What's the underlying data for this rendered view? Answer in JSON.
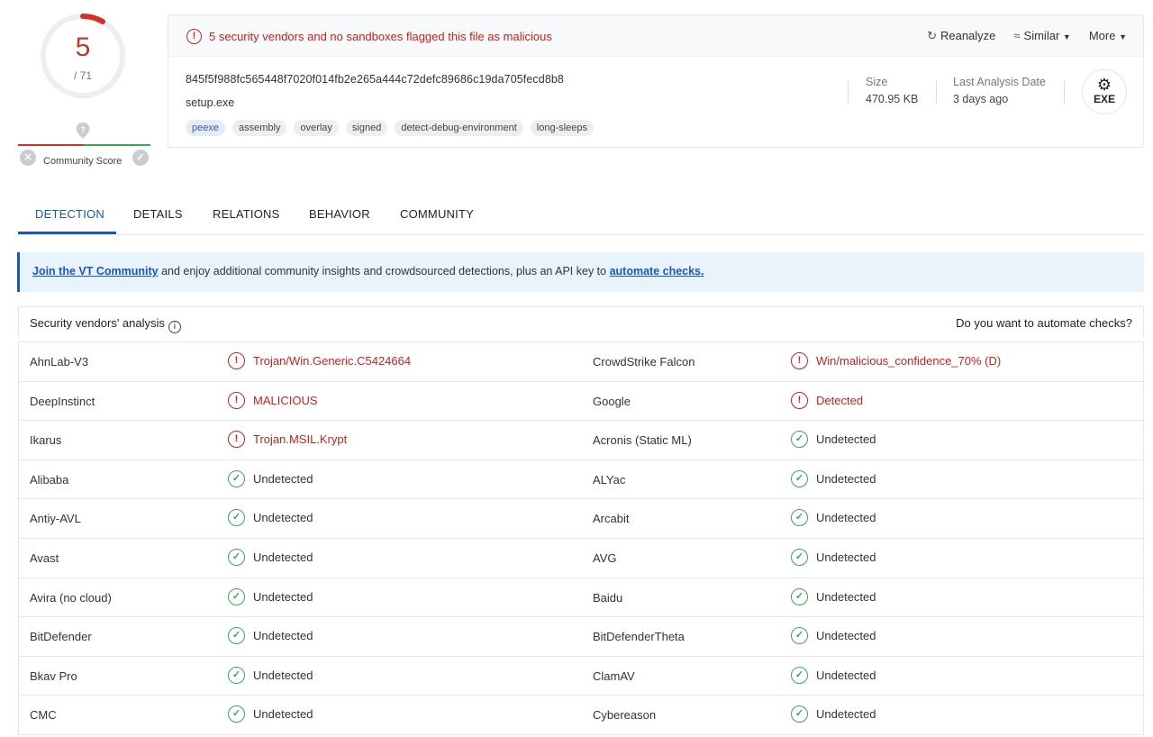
{
  "score": {
    "detections": "5",
    "total": "/ 71"
  },
  "community": {
    "label": "Community Score"
  },
  "alert": {
    "text": "5 security vendors and no sandboxes flagged this file as malicious"
  },
  "actions": {
    "reanalyze": "Reanalyze",
    "similar": "Similar",
    "more": "More"
  },
  "file": {
    "hash": "845f5f988fc565448f7020f014fb2e265a444c72defc89686c19da705fecd8b8",
    "name": "setup.exe",
    "tags": [
      "peexe",
      "assembly",
      "overlay",
      "signed",
      "detect-debug-environment",
      "long-sleeps"
    ],
    "size_label": "Size",
    "size": "470.95 KB",
    "date_label": "Last Analysis Date",
    "date": "3 days ago",
    "type": "EXE"
  },
  "tabs": [
    "DETECTION",
    "DETAILS",
    "RELATIONS",
    "BEHAVIOR",
    "COMMUNITY"
  ],
  "banner": {
    "link": "Join the VT Community",
    "middle": " and enjoy additional community insights and crowdsourced detections, plus an API key to ",
    "link2": "automate checks."
  },
  "vendors_header": {
    "title": "Security vendors' analysis",
    "right": "Do you want to automate checks?"
  },
  "vendors": [
    [
      {
        "name": "AhnLab-V3",
        "result": "Trojan/Win.Generic.C5424664",
        "status": "malicious"
      },
      {
        "name": "CrowdStrike Falcon",
        "result": "Win/malicious_confidence_70% (D)",
        "status": "malicious"
      }
    ],
    [
      {
        "name": "DeepInstinct",
        "result": "MALICIOUS",
        "status": "malicious"
      },
      {
        "name": "Google",
        "result": "Detected",
        "status": "malicious"
      }
    ],
    [
      {
        "name": "Ikarus",
        "result": "Trojan.MSIL.Krypt",
        "status": "malicious"
      },
      {
        "name": "Acronis (Static ML)",
        "result": "Undetected",
        "status": "clean"
      }
    ],
    [
      {
        "name": "Alibaba",
        "result": "Undetected",
        "status": "clean"
      },
      {
        "name": "ALYac",
        "result": "Undetected",
        "status": "clean"
      }
    ],
    [
      {
        "name": "Antiy-AVL",
        "result": "Undetected",
        "status": "clean"
      },
      {
        "name": "Arcabit",
        "result": "Undetected",
        "status": "clean"
      }
    ],
    [
      {
        "name": "Avast",
        "result": "Undetected",
        "status": "clean"
      },
      {
        "name": "AVG",
        "result": "Undetected",
        "status": "clean"
      }
    ],
    [
      {
        "name": "Avira (no cloud)",
        "result": "Undetected",
        "status": "clean"
      },
      {
        "name": "Baidu",
        "result": "Undetected",
        "status": "clean"
      }
    ],
    [
      {
        "name": "BitDefender",
        "result": "Undetected",
        "status": "clean"
      },
      {
        "name": "BitDefenderTheta",
        "result": "Undetected",
        "status": "clean"
      }
    ],
    [
      {
        "name": "Bkav Pro",
        "result": "Undetected",
        "status": "clean"
      },
      {
        "name": "ClamAV",
        "result": "Undetected",
        "status": "clean"
      }
    ],
    [
      {
        "name": "CMC",
        "result": "Undetected",
        "status": "clean"
      },
      {
        "name": "Cybereason",
        "result": "Undetected",
        "status": "clean"
      }
    ]
  ]
}
